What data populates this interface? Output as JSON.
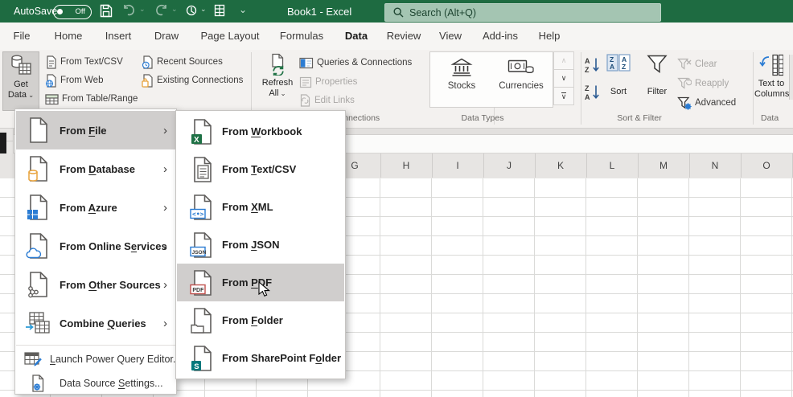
{
  "titlebar": {
    "autosave_label": "AutoSave",
    "autosave_state": "Off",
    "title": "Book1 - Excel",
    "search_placeholder": "Search (Alt+Q)"
  },
  "icons": {
    "chevron_down": "⌄",
    "submenu_arrow": "›",
    "scroll_up": "∧",
    "scroll_down": "∨"
  },
  "tabs": [
    {
      "label": "File"
    },
    {
      "label": "Home"
    },
    {
      "label": "Insert"
    },
    {
      "label": "Draw"
    },
    {
      "label": "Page Layout"
    },
    {
      "label": "Formulas"
    },
    {
      "label": "Data",
      "active": true
    },
    {
      "label": "Review"
    },
    {
      "label": "View"
    },
    {
      "label": "Add-ins"
    },
    {
      "label": "Help"
    }
  ],
  "ribbon": {
    "get_data_line1": "Get",
    "get_data_line2": "Data",
    "from_text_csv": "From Text/CSV",
    "from_web": "From Web",
    "from_table_range": "From Table/Range",
    "recent_sources": "Recent Sources",
    "existing_connections": "Existing Connections",
    "refresh_line1": "Refresh",
    "refresh_line2": "All",
    "queries_connections": "Queries & Connections",
    "properties": "Properties",
    "edit_links": "Edit Links",
    "stocks": "Stocks",
    "currencies": "Currencies",
    "sort": "Sort",
    "filter": "Filter",
    "clear": "Clear",
    "reapply": "Reapply",
    "advanced": "Advanced",
    "ttc_line1": "Text to",
    "ttc_line2": "Columns",
    "group_connections": "Connections",
    "group_data_types": "Data Types",
    "group_sort_filter": "Sort & Filter",
    "group_data": "Data"
  },
  "menu": {
    "items": [
      {
        "pre": "From ",
        "u": "F",
        "post": "ile"
      },
      {
        "pre": "From ",
        "u": "D",
        "post": "atabase"
      },
      {
        "pre": "From ",
        "u": "A",
        "post": "zure"
      },
      {
        "pre": "From Online S",
        "u": "e",
        "post": "rvices"
      },
      {
        "pre": "From ",
        "u": "O",
        "post": "ther Sources"
      },
      {
        "pre": "Combine ",
        "u": "Q",
        "post": "ueries"
      }
    ],
    "footer": [
      {
        "pre": "",
        "u": "L",
        "post": "aunch Power Query Editor..."
      },
      {
        "pre": "Data Source ",
        "u": "S",
        "post": "ettings..."
      }
    ]
  },
  "submenu": {
    "items": [
      {
        "pre": "From ",
        "u": "W",
        "post": "orkbook"
      },
      {
        "pre": "From ",
        "u": "T",
        "post": "ext/CSV"
      },
      {
        "pre": "From ",
        "u": "X",
        "post": "ML"
      },
      {
        "pre": "From ",
        "u": "J",
        "post": "SON"
      },
      {
        "pre": "From ",
        "u": "P",
        "post": "DF"
      },
      {
        "pre": "From ",
        "u": "F",
        "post": "older"
      },
      {
        "pre": "From SharePoint F",
        "u": "o",
        "post": "lder"
      }
    ]
  },
  "sheet": {
    "columns": [
      "G",
      "H",
      "I",
      "J",
      "K",
      "L",
      "M",
      "N",
      "O"
    ]
  }
}
